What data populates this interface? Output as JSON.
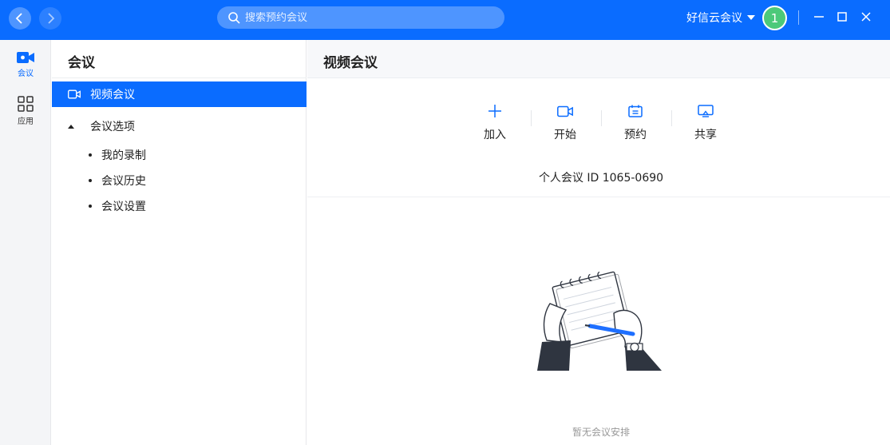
{
  "topbar": {
    "search_placeholder": "搜索预约会议",
    "account_name": "好信云会议",
    "avatar_text": "1"
  },
  "rail": {
    "items": [
      {
        "label": "会议",
        "icon": "video-camera-icon",
        "active": true
      },
      {
        "label": "应用",
        "icon": "apps-grid-icon",
        "active": false
      }
    ]
  },
  "sidebar": {
    "title": "会议",
    "active_item": "视频会议",
    "group_label": "会议选项",
    "sub_items": [
      "我的录制",
      "会议历史",
      "会议设置"
    ]
  },
  "main": {
    "title": "视频会议",
    "actions": [
      {
        "label": "加入",
        "icon": "plus-icon"
      },
      {
        "label": "开始",
        "icon": "video-camera-icon"
      },
      {
        "label": "预约",
        "icon": "calendar-icon"
      },
      {
        "label": "共享",
        "icon": "screen-share-icon"
      }
    ],
    "meeting_id_text": "个人会议 ID 1065-0690",
    "empty_text": "暂无会议安排"
  },
  "colors": {
    "brand": "#0a6cff",
    "avatar": "#4cc97a"
  }
}
